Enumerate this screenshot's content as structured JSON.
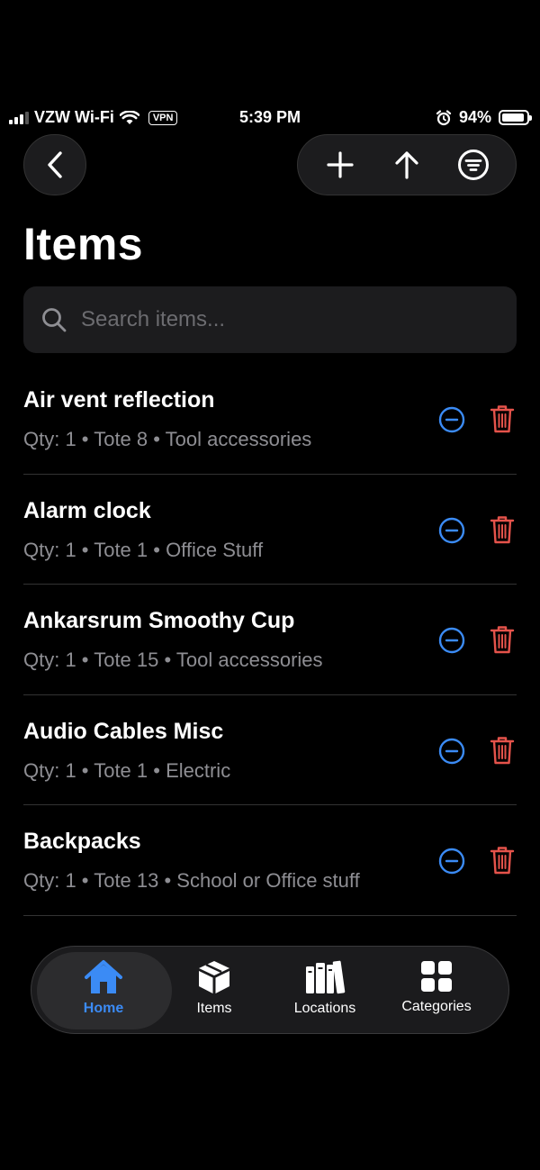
{
  "status_bar": {
    "carrier": "VZW Wi-Fi",
    "vpn": "VPN",
    "time": "5:39 PM",
    "battery": "94%",
    "battery_level": 0.94
  },
  "header": {
    "title": "Items",
    "actions": [
      "plus-icon",
      "arrow-up-icon",
      "filter-icon"
    ]
  },
  "search": {
    "placeholder": "Search items..."
  },
  "items": [
    {
      "name": "Air vent reflection",
      "meta": "Qty: 1 • Tote 8 • Tool accessories"
    },
    {
      "name": "Alarm clock",
      "meta": "Qty: 1 • Tote 1 • Office Stuff"
    },
    {
      "name": "Ankarsrum Smoothy Cup",
      "meta": "Qty: 1 • Tote 15 • Tool accessories"
    },
    {
      "name": "Audio Cables Misc",
      "meta": "Qty: 1 • Tote 1 • Electric"
    },
    {
      "name": "Backpacks",
      "meta": "Qty: 1 • Tote 13 • School or Office stuff"
    }
  ],
  "tabs": [
    {
      "label": "Home",
      "icon": "house-icon",
      "active": true
    },
    {
      "label": "Items",
      "icon": "box-icon",
      "active": false
    },
    {
      "label": "Locations",
      "icon": "books-icon",
      "active": false
    },
    {
      "label": "Categories",
      "icon": "grid-icon",
      "active": false
    }
  ],
  "colors": {
    "accent": "#3b8bf5",
    "destructive": "#e5534b",
    "secondary_text": "#8e8e93"
  }
}
